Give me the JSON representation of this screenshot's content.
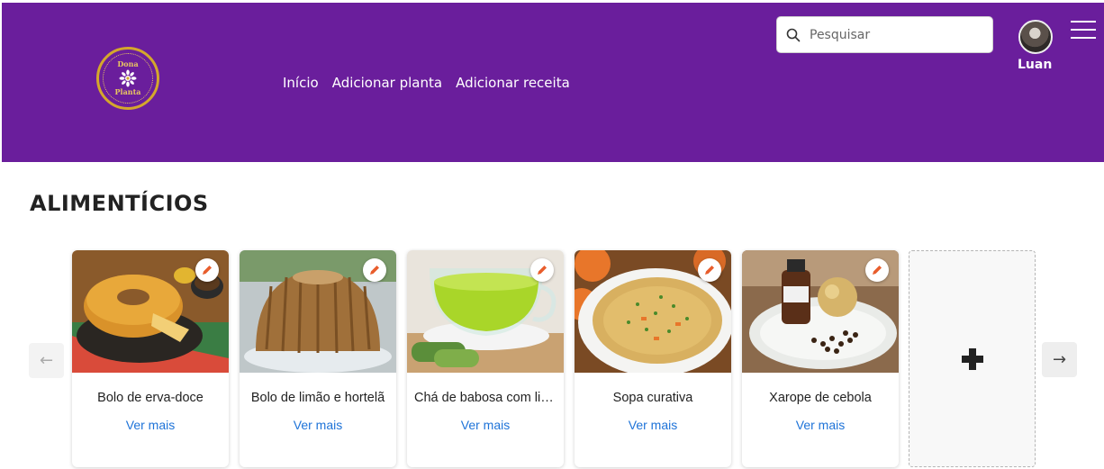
{
  "header": {
    "background": "#6a1e9c",
    "logo": {
      "text_top": "Dona",
      "text_bottom": "Planta"
    },
    "nav": [
      {
        "label": "Início"
      },
      {
        "label": "Adicionar planta"
      },
      {
        "label": "Adicionar receita"
      }
    ],
    "search": {
      "placeholder": "Pesquisar",
      "value": "",
      "icon": "search-icon"
    },
    "user": {
      "name": "Luan",
      "avatar": "avatar-photo"
    },
    "menu_icon": "hamburger-menu-icon"
  },
  "section": {
    "title": "ALIMENTÍCIOS",
    "cards": [
      {
        "title": "Bolo de erva-doce",
        "link": "Ver mais",
        "image": "cake-with-coffee",
        "edit_icon": "pencil-icon"
      },
      {
        "title": "Bolo de limão e hortelã",
        "link": "Ver mais",
        "image": "bundt-cake",
        "edit_icon": "pencil-icon"
      },
      {
        "title": "Chá de babosa com limão",
        "link": "Ver mais",
        "image": "green-tea-cup",
        "edit_icon": "pencil-icon"
      },
      {
        "title": "Sopa curativa",
        "link": "Ver mais",
        "image": "soup-bowl",
        "edit_icon": "pencil-icon"
      },
      {
        "title": "Xarope de cebola",
        "link": "Ver mais",
        "image": "onion-syrup",
        "edit_icon": "pencil-icon"
      }
    ],
    "add_card_icon": "plus-icon",
    "prev_arrow": "←",
    "next_arrow": "→"
  },
  "colors": {
    "accent": "#6a1e9c",
    "link": "#1e73d8",
    "logo_gold": "#d4a72c"
  }
}
